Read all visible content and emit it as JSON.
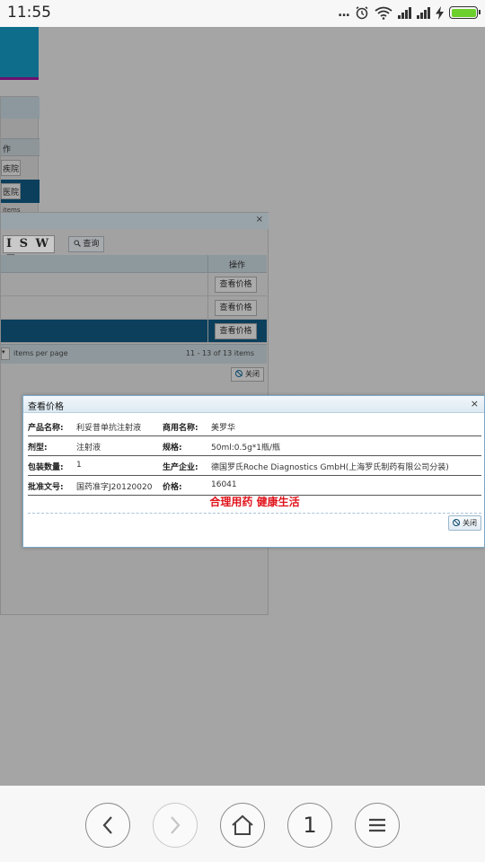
{
  "status_bar": {
    "time": "11:55",
    "dots": "...",
    "battery_color": "#6ccf2c"
  },
  "background_page": {
    "left_panel": {
      "column_header": "作",
      "button_1": "疾院",
      "button_2": "医院",
      "items_text": "items"
    },
    "search_window": {
      "captcha_text": "I S W E",
      "query_button": "查询",
      "column_header_action": "操作",
      "rows": [
        {
          "action_label": "查看价格"
        },
        {
          "action_label": "查看价格"
        },
        {
          "action_label": "查看价格"
        }
      ],
      "pager": {
        "per_page_label": "items per page",
        "range_text": "11 - 13 of 13 items"
      },
      "close_button": "关闭"
    }
  },
  "price_dialog": {
    "title": "查看价格",
    "close_x": "×",
    "rows": [
      {
        "label1": "产品名称:",
        "value1": "利妥昔单抗注射液",
        "label2": "商用名称:",
        "value2": "美罗华"
      },
      {
        "label1": "剂型:",
        "value1": "注射液",
        "label2": "规格:",
        "value2": "50ml:0.5g*1瓶/瓶"
      },
      {
        "label1": "包装数量:",
        "value1": "1",
        "label2": "生产企业:",
        "value2": "德国罗氏Roche Diagnostics GmbH(上海罗氏制药有限公司分装)"
      },
      {
        "label1": "批准文号:",
        "value1": "国药准字J20120020",
        "label2": "价格:",
        "value2": "16041"
      }
    ],
    "slogan": "合理用药 健康生活",
    "slogan_color": "#e0141c",
    "close_button": "关闭"
  },
  "bottom_nav": {
    "back_icon": "chevron-left-icon",
    "forward_icon": "chevron-right-icon",
    "home_icon": "home-icon",
    "tab_count": "1",
    "menu_icon": "hamburger-menu-icon"
  }
}
